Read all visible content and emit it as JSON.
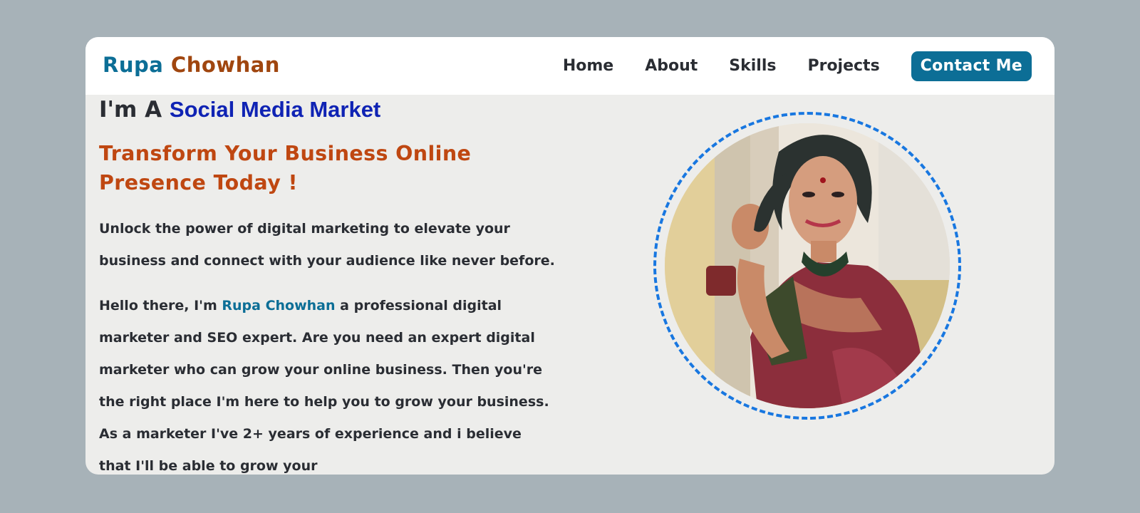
{
  "brand": {
    "first_name": "Rupa",
    "last_name": "Chowhan"
  },
  "nav": {
    "items": [
      {
        "label": "Home"
      },
      {
        "label": "About"
      },
      {
        "label": "Skills"
      },
      {
        "label": "Projects"
      }
    ],
    "contact_label": "Contact Me"
  },
  "hero": {
    "role_prefix": "I'm A",
    "role_text": "Social Media Market",
    "headline": "Transform Your Business Online Presence Today !",
    "intro": "Unlock the power of digital marketing to elevate your business and connect with your audience like never before.",
    "bio_prefix": "Hello there, I'm",
    "bio_name": "Rupa Chowhan",
    "bio_text": "a professional digital marketer and SEO expert. Are you need an expert digital marketer who can grow your online business. Then you're the right place I'm here to help you to grow your business. As a marketer I've 2+ years of experience and i believe that I'll be able to grow your"
  },
  "colors": {
    "brand_blue": "#0c6e96",
    "brand_brown": "#a0460f",
    "headline_orange": "#bf4711",
    "role_blue": "#0f23b4",
    "ring_blue": "#1877e0",
    "page_bg": "#a7b2b8",
    "card_bg": "#ededeb"
  }
}
